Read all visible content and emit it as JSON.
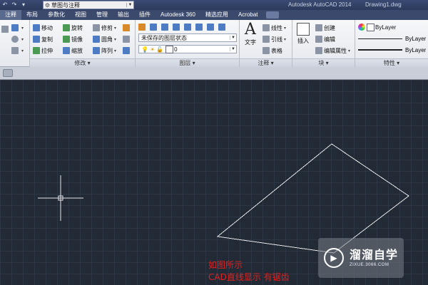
{
  "titlebar": {
    "workspace": "草图与注释",
    "app_title": "Autodesk AutoCAD 2014",
    "doc_title": "Drawing1.dwg"
  },
  "tabs": [
    "注释",
    "布局",
    "参数化",
    "视图",
    "管理",
    "输出",
    "插件",
    "Autodesk 360",
    "精选应用",
    "Acrobat"
  ],
  "ribbon": {
    "modify": {
      "title": "修改",
      "items": [
        "移动",
        "旋转",
        "修剪",
        "复制",
        "镜像",
        "圆角",
        "拉伸",
        "缩放",
        "阵列"
      ]
    },
    "layers": {
      "title": "图层",
      "layer_state": "未保存的图层状态",
      "current_layer": "0"
    },
    "annotation": {
      "title": "注释",
      "text_label": "文字",
      "items": [
        "线性",
        "引线",
        "表格"
      ]
    },
    "block": {
      "title": "块",
      "insert_label": "插入",
      "items": [
        "创建",
        "编辑",
        "编辑属性"
      ]
    },
    "properties": {
      "title": "特性",
      "color": "ByLayer",
      "linetype": "ByLayer",
      "lineweight": "ByLayer"
    }
  },
  "canvas": {
    "background": "#222a36",
    "line_color": "#e6e6e6"
  },
  "caption": {
    "line1": "如图所示",
    "line2": "CAD直线显示 有锯齿",
    "color": "#e0211f"
  },
  "watermark": {
    "name": "溜溜自学",
    "url": "ZIXUE.3066.COM"
  }
}
